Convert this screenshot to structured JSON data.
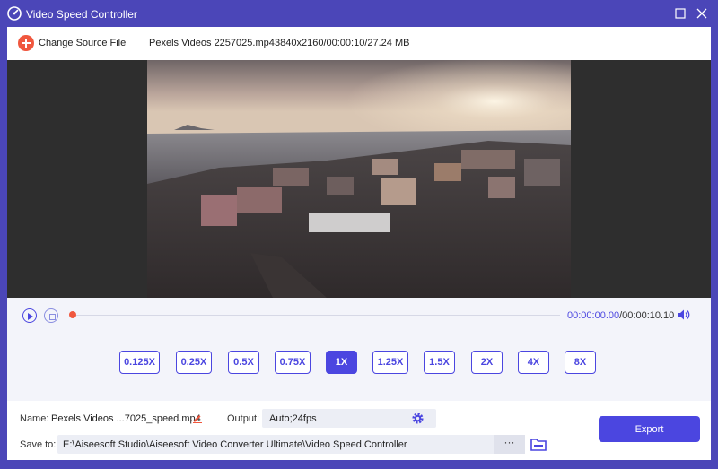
{
  "window": {
    "title": "Video Speed Controller",
    "app_icon": "speedometer-icon",
    "accent_color": "#4b46e0",
    "frame_color": "#4b46b8"
  },
  "toolbar": {
    "change_source_label": "Change Source File",
    "add_icon": "plus-circle-icon",
    "filename": "Pexels Videos 2257025.mp4",
    "fileinfo": "3840x2160/00:00:10/27.24 MB"
  },
  "player": {
    "current_time": "00:00:00.00",
    "total_time": "/00:00:10.10",
    "progress": 0
  },
  "speeds": [
    {
      "label": "0.125X",
      "active": false
    },
    {
      "label": "0.25X",
      "active": false
    },
    {
      "label": "0.5X",
      "active": false
    },
    {
      "label": "0.75X",
      "active": false
    },
    {
      "label": "1X",
      "active": true
    },
    {
      "label": "1.25X",
      "active": false
    },
    {
      "label": "1.5X",
      "active": false
    },
    {
      "label": "2X",
      "active": false
    },
    {
      "label": "4X",
      "active": false
    },
    {
      "label": "8X",
      "active": false
    }
  ],
  "output": {
    "name_label": "Name:",
    "name_value": "Pexels Videos ...7025_speed.mp4",
    "output_label": "Output:",
    "output_value": "Auto;24fps",
    "save_label": "Save to:",
    "save_path": "E:\\Aiseesoft Studio\\Aiseesoft Video Converter Ultimate\\Video Speed Controller",
    "browse_label": "···",
    "export_label": "Export"
  }
}
